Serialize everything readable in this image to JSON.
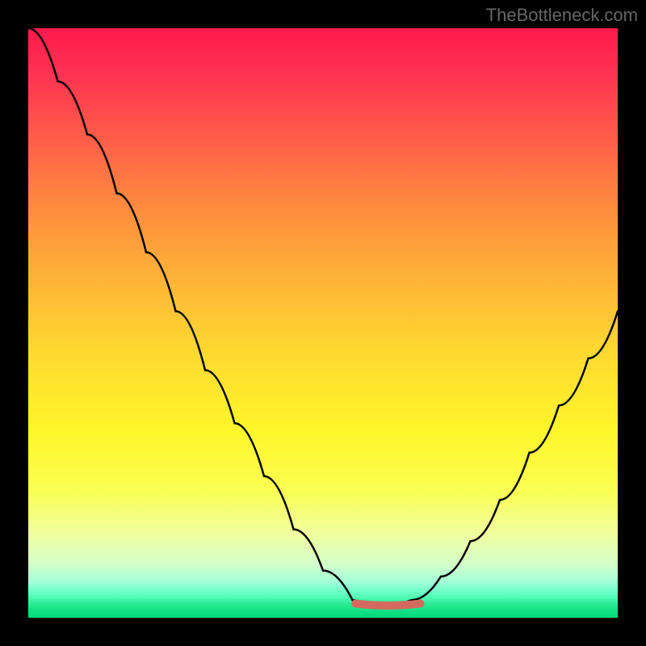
{
  "watermark": "TheBottleneck.com",
  "chart_data": {
    "type": "line",
    "title": "",
    "xlabel": "",
    "ylabel": "",
    "x": [
      0.0,
      0.05,
      0.1,
      0.15,
      0.2,
      0.25,
      0.3,
      0.35,
      0.4,
      0.45,
      0.5,
      0.55,
      0.575,
      0.6,
      0.65,
      0.7,
      0.75,
      0.8,
      0.85,
      0.9,
      0.95,
      1.0
    ],
    "y": [
      1.0,
      0.91,
      0.82,
      0.72,
      0.62,
      0.52,
      0.42,
      0.33,
      0.24,
      0.15,
      0.08,
      0.03,
      0.02,
      0.02,
      0.03,
      0.07,
      0.13,
      0.2,
      0.28,
      0.36,
      0.44,
      0.52
    ],
    "xlim": [
      0,
      1
    ],
    "ylim": [
      0,
      1
    ],
    "marker": {
      "x_range": [
        0.555,
        0.665
      ],
      "y": 0.02
    }
  }
}
